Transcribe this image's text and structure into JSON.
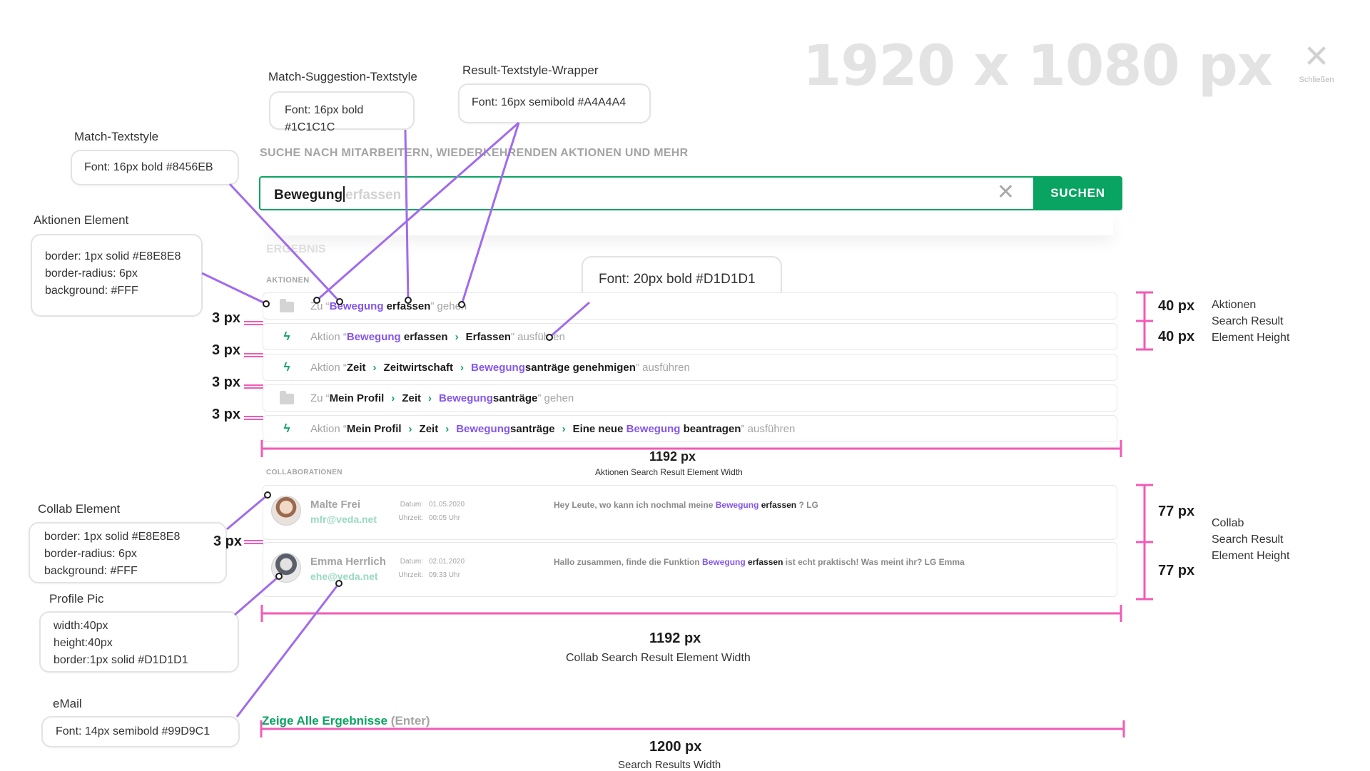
{
  "overlay": {
    "dimensions": "1920 x 1080 px",
    "close_label": "Schließen"
  },
  "annotations": {
    "match_suggestion": {
      "title": "Match-Suggestion-Textstyle",
      "body": [
        "Font: 16px bold #1C1C1C"
      ]
    },
    "result_wrapper": {
      "title": "Result-Textstyle-Wrapper",
      "body": [
        "Font: 16px semibold #A4A4A4"
      ]
    },
    "match": {
      "title": "Match-Textstyle",
      "body": [
        "Font: 16px bold #8456EB"
      ]
    },
    "aktionen_element": {
      "title": "Aktionen Element",
      "body": [
        "border: 1px solid #E8E8E8",
        "border-radius: 6px",
        "background: #FFF"
      ]
    },
    "chevron_font": {
      "body": [
        "Font: 20px bold #D1D1D1"
      ]
    },
    "collab_element": {
      "title": "Collab Element",
      "body": [
        "border: 1px solid #E8E8E8",
        "border-radius: 6px",
        "background: #FFF"
      ]
    },
    "profile_pic": {
      "title": "Profile Pic",
      "body": [
        "width:40px",
        "height:40px",
        "border:1px solid #D1D1D1"
      ]
    },
    "email": {
      "title": "eMail",
      "body": [
        "Font: 14px semibold #99D9C1"
      ]
    }
  },
  "search": {
    "heading": "SUCHE NACH MITARBEITERN, WIEDERKEHRENDEN AKTIONEN UND MEHR",
    "typed": "Bewegung",
    "suggestion": "erfassen",
    "button": "SUCHEN"
  },
  "results": {
    "title": "ERGEBNIS",
    "aktionen_label": "AKTIONEN",
    "collab_label": "COLLABORATIONEN",
    "show_all": "Zeige Alle Ergebnisse",
    "show_all_hint": "(Enter)"
  },
  "aktionen": [
    {
      "icon": "folder-icon",
      "prefix": "Zu “",
      "parts": [
        {
          "t": "Bewegung",
          "s": "m"
        },
        {
          "t": " erfassen",
          "s": "b"
        }
      ],
      "suffix": "” gehen"
    },
    {
      "icon": "bolt-icon",
      "prefix": "Aktion “",
      "parts": [
        {
          "t": "Bewegung",
          "s": "m"
        },
        {
          "t": " erfassen",
          "s": "b"
        },
        {
          "t": ">",
          "s": "c"
        },
        {
          "t": "Erfassen",
          "s": "b"
        }
      ],
      "suffix": "” ausführen"
    },
    {
      "icon": "bolt-icon",
      "prefix": "Aktion “",
      "parts": [
        {
          "t": "Zeit",
          "s": "b"
        },
        {
          "t": ">",
          "s": "c"
        },
        {
          "t": "Zeitwirtschaft",
          "s": "b"
        },
        {
          "t": ">",
          "s": "c"
        },
        {
          "t": "Bewegung",
          "s": "m"
        },
        {
          "t": "santräge genehmigen",
          "s": "b"
        }
      ],
      "suffix": "” ausführen"
    },
    {
      "icon": "folder-icon",
      "prefix": "Zu “",
      "parts": [
        {
          "t": "Mein Profil",
          "s": "b"
        },
        {
          "t": ">",
          "s": "c"
        },
        {
          "t": "Zeit",
          "s": "b"
        },
        {
          "t": ">",
          "s": "c"
        },
        {
          "t": "Bewegung",
          "s": "m"
        },
        {
          "t": "santräge",
          "s": "b"
        }
      ],
      "suffix": "” gehen"
    },
    {
      "icon": "bolt-icon",
      "prefix": "Aktion “",
      "parts": [
        {
          "t": "Mein Profil",
          "s": "b"
        },
        {
          "t": ">",
          "s": "c"
        },
        {
          "t": "Zeit",
          "s": "b"
        },
        {
          "t": ">",
          "s": "c"
        },
        {
          "t": "Bewegung",
          "s": "m"
        },
        {
          "t": "santräge",
          "s": "b"
        },
        {
          "t": ">",
          "s": "c"
        },
        {
          "t": "Eine neue ",
          "s": "b"
        },
        {
          "t": "Bewegung",
          "s": "m"
        },
        {
          "t": " beantragen",
          "s": "b"
        }
      ],
      "suffix": "” ausführen"
    }
  ],
  "collabs": [
    {
      "name": "Malte Frei",
      "email": "mfr@veda.net",
      "date_label": "Datum:",
      "date": "01.05.2020",
      "time_label": "Uhrzeit:",
      "time": "00:05 Uhr",
      "msg": [
        {
          "t": "Hey Leute, wo kann ich nochmal meine ",
          "s": ""
        },
        {
          "t": "Bewegung",
          "s": "m"
        },
        {
          "t": " erfassen",
          "s": "b"
        },
        {
          "t": " ? LG",
          "s": ""
        }
      ]
    },
    {
      "name": "Emma Herrlich",
      "email": "ehe@veda.net",
      "date_label": "Datum:",
      "date": "02.01.2020",
      "time_label": "Uhrzeit:",
      "time": "09:33 Uhr",
      "msg": [
        {
          "t": "Hallo zusammen, finde die Funktion ",
          "s": ""
        },
        {
          "t": "Bewegung",
          "s": "m"
        },
        {
          "t": " erfassen",
          "s": "b"
        },
        {
          "t": " ist echt praktisch! Was meint ihr? LG Emma",
          "s": ""
        }
      ]
    }
  ],
  "dimensions": {
    "gap": "3 px",
    "row_h": "40 px",
    "collab_h": "77 px",
    "aktionen_w": "1192 px",
    "aktionen_w_cap": "Aktionen Search Result Element Width",
    "collab_w": "1192 px",
    "collab_w_cap": "Collab Search Result Element Width",
    "results_w": "1200 px",
    "results_w_cap": "Search Results Width",
    "aktionen_side": [
      "Aktionen",
      "Search Result",
      "Element Height"
    ],
    "collab_side": [
      "Collab",
      "Search Result",
      "Element Height"
    ]
  },
  "colors": {
    "accent": "#0AA462",
    "match": "#8456EB",
    "secondary": "#A4A4A4",
    "measure": "#F15BB5",
    "pointer": "#A16BEB"
  }
}
